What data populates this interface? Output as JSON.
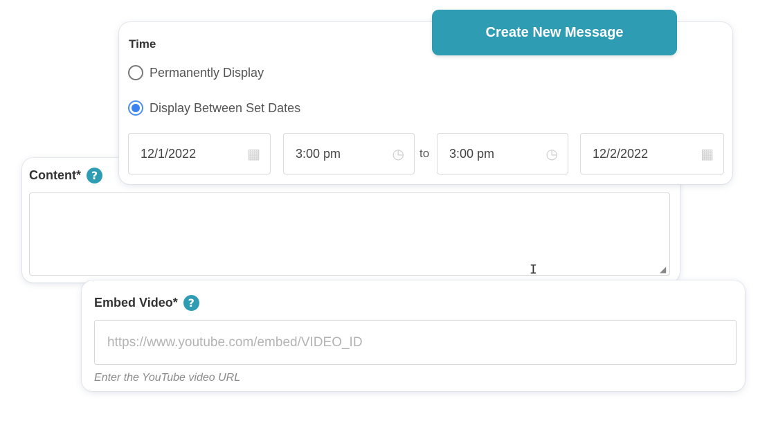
{
  "header": {
    "create_button_label": "Create New Message"
  },
  "time": {
    "title": "Time",
    "options": [
      {
        "label": "Permanently Display",
        "checked": false
      },
      {
        "label": "Display Between Set Dates",
        "checked": true
      }
    ],
    "start_date": "12/1/2022",
    "start_time": "3:00 pm",
    "to_label": "to",
    "end_time": "3:00 pm",
    "end_date": "12/2/2022",
    "icons": {
      "date": "calendar-icon",
      "time": "clock-icon"
    }
  },
  "content": {
    "label": "Content*",
    "help_icon": "help-icon",
    "value": ""
  },
  "video": {
    "label": "Embed Video*",
    "help_icon": "help-icon",
    "placeholder": "https://www.youtube.com/embed/VIDEO_ID",
    "hint": "Enter the YouTube video URL"
  },
  "colors": {
    "accent": "#2e9db4",
    "radio_selected": "#3b82f0"
  }
}
